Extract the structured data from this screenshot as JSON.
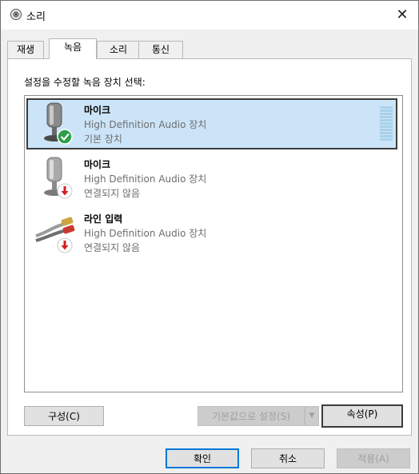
{
  "window": {
    "title": "소리",
    "title_icon": "speaker-icon",
    "close_glyph": "✕"
  },
  "tabs": [
    {
      "label": "재생",
      "active": false
    },
    {
      "label": "녹음",
      "active": true
    },
    {
      "label": "소리",
      "active": false
    },
    {
      "label": "통신",
      "active": false
    }
  ],
  "instruction": "설정을 수정할 녹음 장치 선택:",
  "devices": [
    {
      "name": "마이크",
      "description": "High Definition Audio 장치",
      "status": "기본 장치",
      "icon": "microphone-icon",
      "badge": "default-check-icon",
      "selected": true
    },
    {
      "name": "마이크",
      "description": "High Definition Audio 장치",
      "status": "연결되지 않음",
      "icon": "microphone-icon",
      "badge": "unplugged-arrow-icon",
      "selected": false
    },
    {
      "name": "라인 입력",
      "description": "High Definition Audio 장치",
      "status": "연결되지 않음",
      "icon": "line-in-cable-icon",
      "badge": "unplugged-arrow-icon",
      "selected": false
    }
  ],
  "panel_buttons": {
    "configure": "구성(C)",
    "set_default": "기본값으로 설정(S)",
    "properties": "속성(P)"
  },
  "dialog_buttons": {
    "ok": "확인",
    "cancel": "취소",
    "apply": "적용(A)"
  },
  "colors": {
    "selection": "#cce4f7",
    "check_badge": "#2e9e4a",
    "arrow_badge": "#d11f1f",
    "accent": "#0078d7"
  }
}
